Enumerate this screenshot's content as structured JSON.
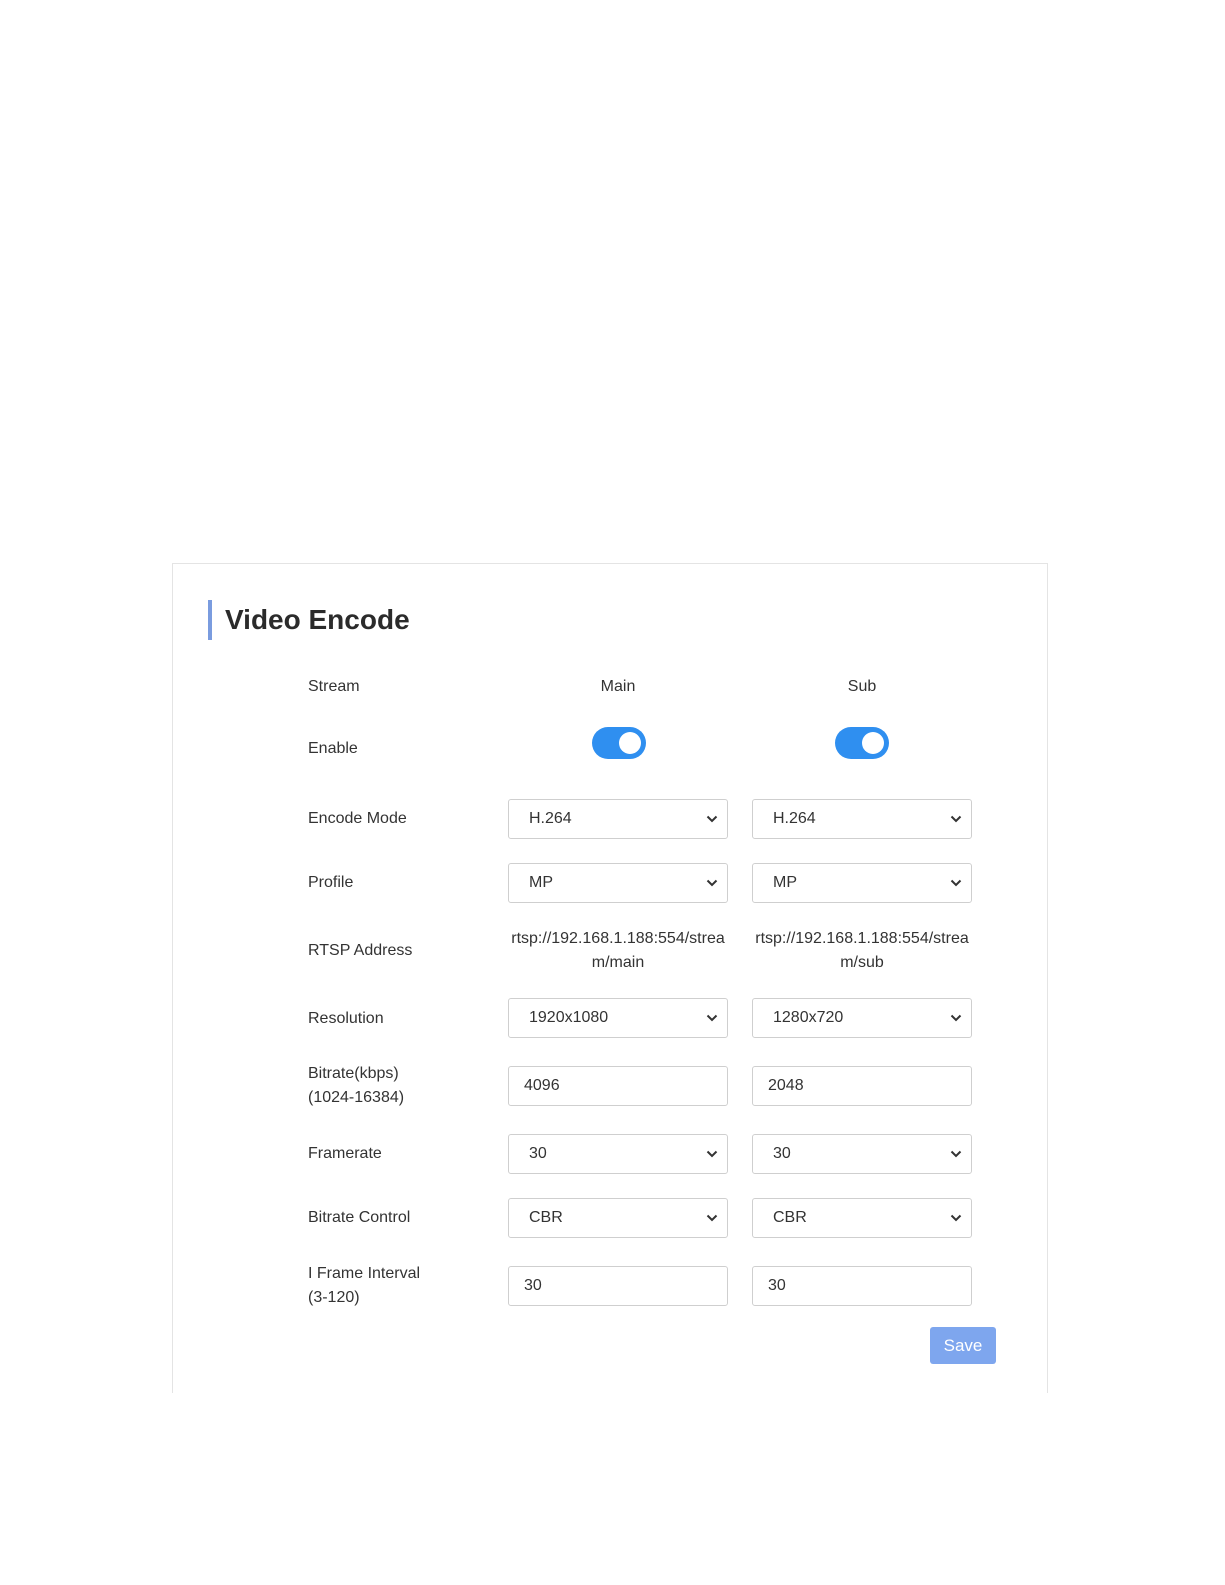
{
  "title": "Video Encode",
  "labels": {
    "stream": "Stream",
    "enable": "Enable",
    "encode_mode": "Encode Mode",
    "profile": "Profile",
    "rtsp_address": "RTSP Address",
    "resolution": "Resolution",
    "bitrate_line1": "Bitrate(kbps)",
    "bitrate_line2": "(1024-16384)",
    "framerate": "Framerate",
    "bitrate_control": "Bitrate Control",
    "iframe_line1": "I Frame Interval",
    "iframe_line2": "(3-120)"
  },
  "main": {
    "header": "Main",
    "enabled": true,
    "encode_mode": "H.264",
    "profile": "MP",
    "rtsp": "rtsp://192.168.1.188:554/stream/main",
    "resolution": "1920x1080",
    "bitrate": "4096",
    "framerate": "30",
    "bitrate_control": "CBR",
    "iframe_interval": "30"
  },
  "sub": {
    "header": "Sub",
    "enabled": true,
    "encode_mode": "H.264",
    "profile": "MP",
    "rtsp": "rtsp://192.168.1.188:554/stream/sub",
    "resolution": "1280x720",
    "bitrate": "2048",
    "framerate": "30",
    "bitrate_control": "CBR",
    "iframe_interval": "30"
  },
  "save_label": "Save",
  "colors": {
    "accent": "#7a9cdf",
    "toggle_on": "#2f8ff0",
    "save_button": "#7ea6ee"
  }
}
